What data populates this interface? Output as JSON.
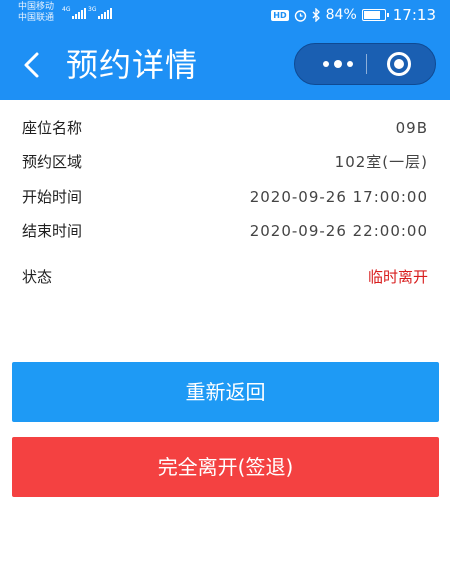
{
  "status_bar": {
    "carrier_1": "中国移动",
    "carrier_2": "中国联通",
    "network_1": "4G",
    "network_2": "3G",
    "hd": "HD",
    "battery": "84%",
    "battery_level": 0.84,
    "time": "17:13"
  },
  "nav": {
    "title": "预约详情",
    "back_icon": "chevron-left-icon",
    "more_icon": "more-dots-icon",
    "close_icon": "target-close-icon"
  },
  "details": [
    {
      "label": "座位名称",
      "value": "09B"
    },
    {
      "label": "预约区域",
      "value": "102室(一层)"
    },
    {
      "label": "开始时间",
      "value": "2020-09-26 17:00:00"
    },
    {
      "label": "结束时间",
      "value": "2020-09-26 22:00:00"
    },
    {
      "label": "状态",
      "value": "临时离开"
    }
  ],
  "actions": {
    "return_label": "重新返回",
    "leave_label": "完全离开(签退)"
  },
  "colors": {
    "header": "#1e90f5",
    "return_button": "#1e9af5",
    "leave_button": "#f44141",
    "status_value": "#d81e1e"
  }
}
